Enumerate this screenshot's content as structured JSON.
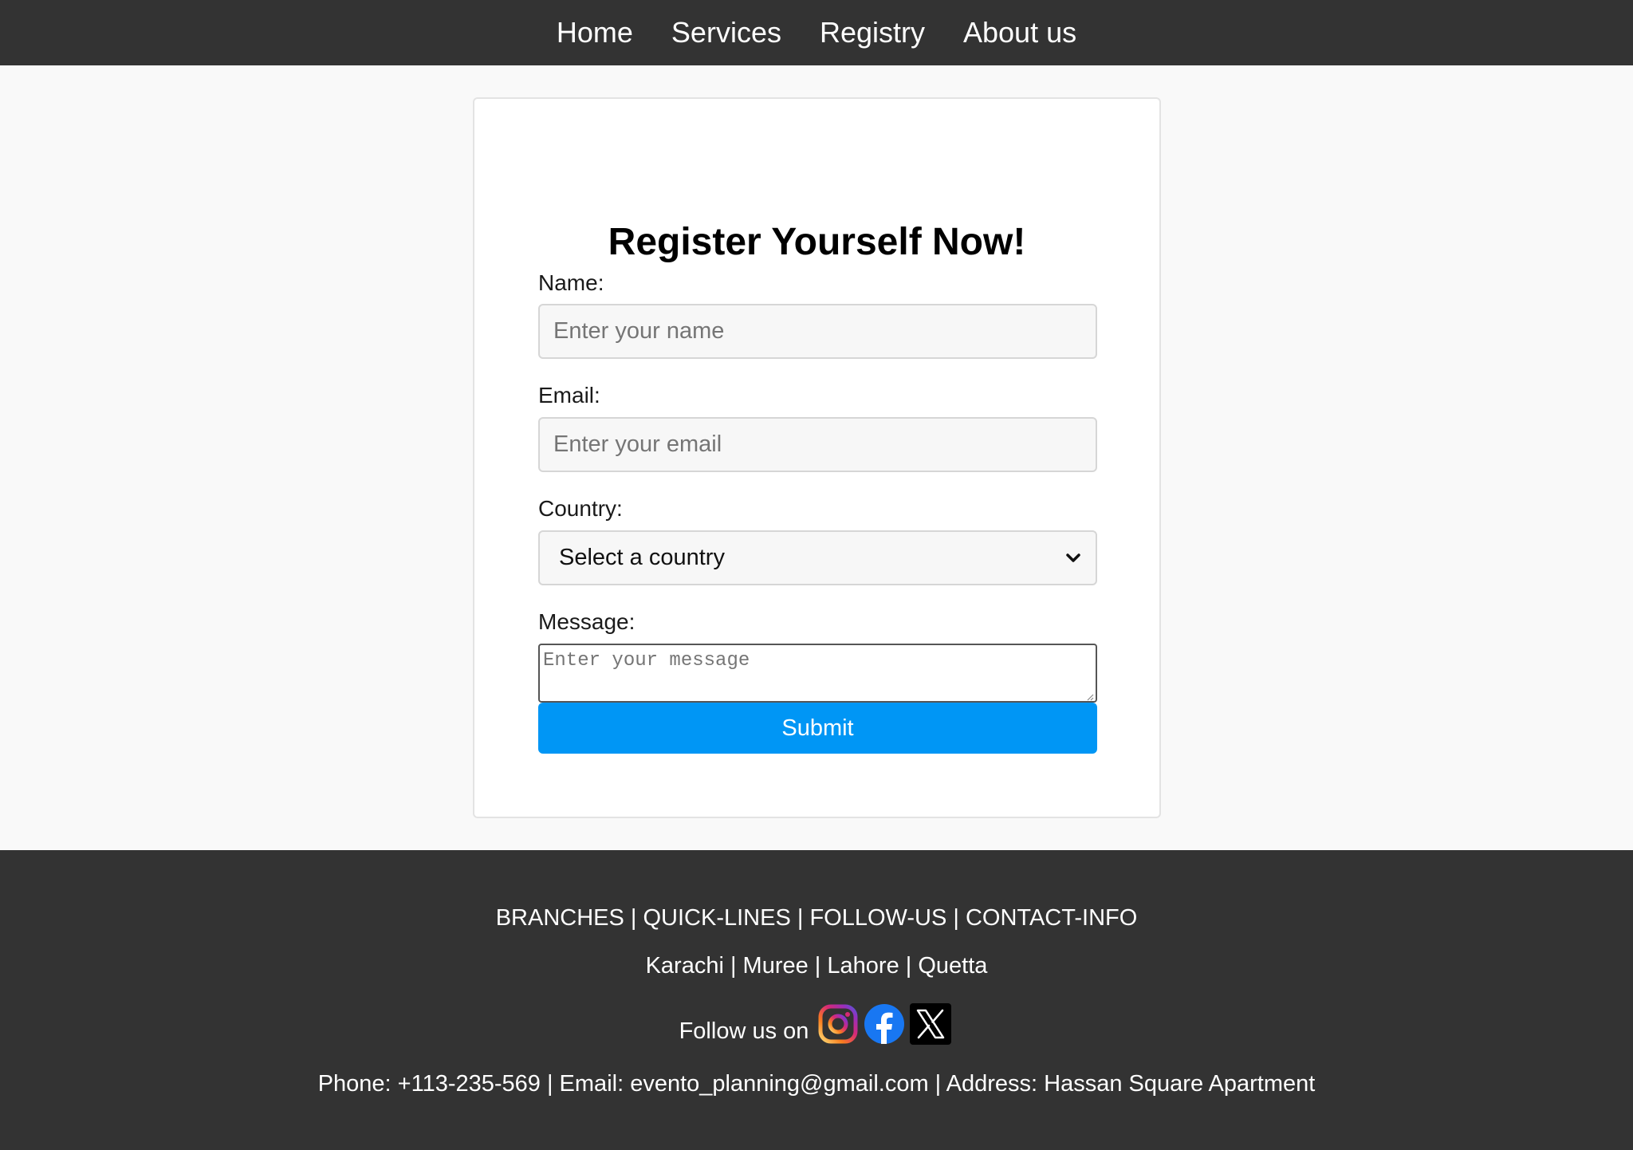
{
  "nav": {
    "links": [
      "Home",
      "Services",
      "Registry",
      "About us"
    ]
  },
  "form": {
    "title": "Register Yourself Now!",
    "name_label": "Name:",
    "name_placeholder": "Enter your name",
    "email_label": "Email:",
    "email_placeholder": "Enter your email",
    "country_label": "Country:",
    "country_selected": "Select a country",
    "message_label": "Message:",
    "message_placeholder": "Enter your message",
    "submit_label": "Submit"
  },
  "footer": {
    "sections": "BRANCHES | QUICK-LINES | FOLLOW-US | CONTACT-INFO",
    "branches": "Karachi | Muree | Lahore | Quetta",
    "follow_text": "Follow us on",
    "social_icons": [
      "instagram-icon",
      "facebook-icon",
      "x-icon"
    ],
    "contact": "Phone: +113-235-569 | Email: evento_planning@gmail.com | Address: Hassan Square Apartment"
  },
  "colors": {
    "nav_bg": "#333333",
    "page_bg": "#f9f9f9",
    "submit_bg": "#0096f5",
    "facebook": "#1877f2"
  }
}
